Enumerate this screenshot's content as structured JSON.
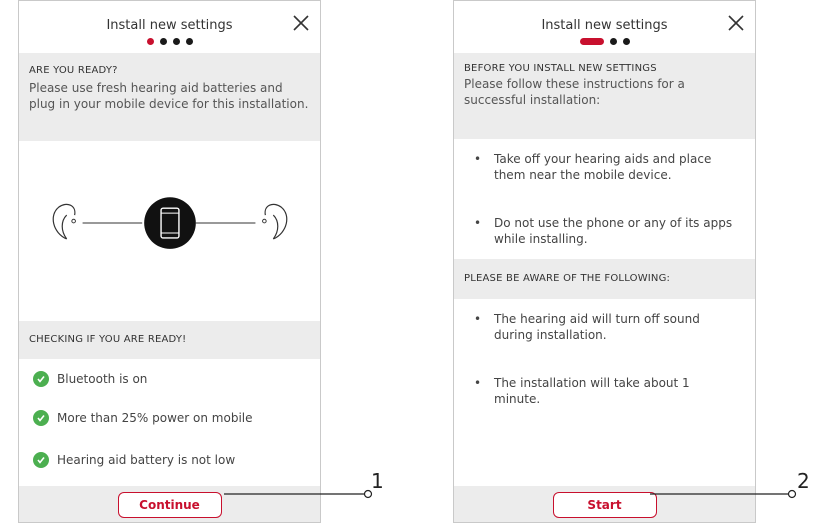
{
  "screen1": {
    "title": "Install new settings",
    "section1_heading": "ARE YOU READY?",
    "section1_text": "Please use fresh hearing aid batteries and plug in your mobile device for this installation.",
    "section2_heading": "CHECKING IF YOU ARE READY!",
    "checks": [
      "Bluetooth is on",
      "More than 25% power on mobile",
      "Hearing aid battery is not low"
    ],
    "button_label": "Continue"
  },
  "screen2": {
    "title": "Install new settings",
    "section1_heading": "BEFORE YOU INSTALL NEW SETTINGS",
    "section1_text": "Please follow these instructions for a successful installation:",
    "instructions": [
      "Take off your hearing aids and place them near the mobile device.",
      "Do not use the phone or any of its apps while installing."
    ],
    "section2_heading": "PLEASE BE AWARE OF THE FOLLOWING:",
    "notes": [
      "The hearing aid will turn off sound during installation.",
      "The installation will take about 1 minute."
    ],
    "button_label": "Start"
  },
  "callouts": [
    "1",
    "2"
  ],
  "icons": {
    "close": "close-icon",
    "check": "check-circle-icon",
    "phone": "mobile-phone-icon",
    "hearing_aid": "hearing-aid-icon"
  },
  "colors": {
    "accent": "#c8102e",
    "check_green": "#4caf50",
    "band_gray": "#ececec"
  }
}
